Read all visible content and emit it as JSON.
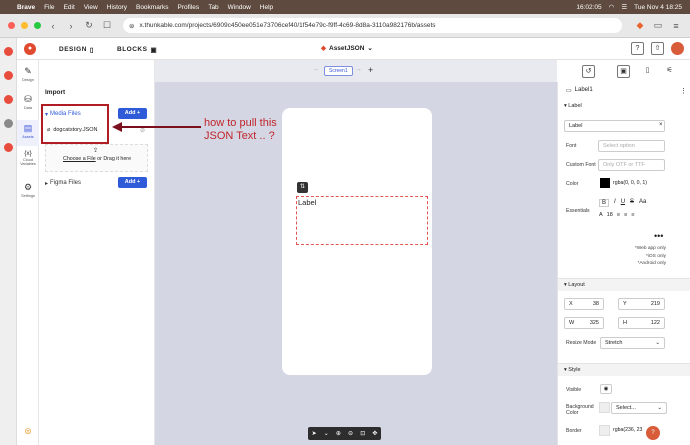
{
  "menubar": {
    "app": "Brave",
    "items": [
      "File",
      "Edit",
      "View",
      "History",
      "Bookmarks",
      "Profiles",
      "Tab",
      "Window",
      "Help"
    ],
    "clock": "16:02:05",
    "datetime": "Tue Nov 4  18:25"
  },
  "browser": {
    "url": "x.thunkable.com/projects/6909c450ee051e73706cef40/1f54e79c-f9ff-4c69-8d8a-3110a982176b/assets"
  },
  "header": {
    "design_tab": "DESIGN",
    "blocks_tab": "BLOCKS",
    "project_name": "AssetJSON"
  },
  "leftnav": {
    "design": "Design",
    "data": "Data",
    "assets": "Assets",
    "variables": "Cloud Variables",
    "variables_icon_text": "{x}",
    "settings": "Settings"
  },
  "assets_panel": {
    "title": "Import",
    "media_files": "Media Files",
    "add_label": "Add",
    "file_name": "dogcatstory.JSON",
    "choose_file": "Choose a File",
    "drag_text": " or Drag it here",
    "figma_files": "Figma Files"
  },
  "annotation": {
    "line1": "how to pull this",
    "line2": "JSON Text .. ?"
  },
  "canvas": {
    "screen_tab": "Screen1",
    "label_text": "Label"
  },
  "props": {
    "title": "Label1",
    "section_label": "Label",
    "text_value": "Label",
    "font_label": "Font",
    "font_placeholder": "Select option",
    "custom_font_label": "Custom Font",
    "custom_font_placeholder": "Only OTF or TTF",
    "color_label": "Color",
    "color_value": "rgba(0, 0, 0, 1)",
    "essentials_label": "Essentials",
    "font_size": "18",
    "legend_web": "*Web app only",
    "legend_ios": "*iOS only",
    "legend_android": "*Android only",
    "layout_section": "Layout",
    "x_label": "X",
    "x_value": "38",
    "y_label": "Y",
    "y_value": "219",
    "w_label": "W",
    "w_value": "325",
    "h_label": "H",
    "h_value": "122",
    "resize_label": "Resize Mode",
    "resize_value": "Stretch",
    "style_section": "Style",
    "visible_label": "Visible",
    "bg_label": "Background Color",
    "bg_value": "Select...",
    "border_label": "Border",
    "border_value": "rgba(236, 23"
  },
  "colors": {
    "accent": "#2f5bd8",
    "annotation": "#c0242b",
    "canvas_bg": "#d4d7e3",
    "logo": "#e04a2e"
  }
}
